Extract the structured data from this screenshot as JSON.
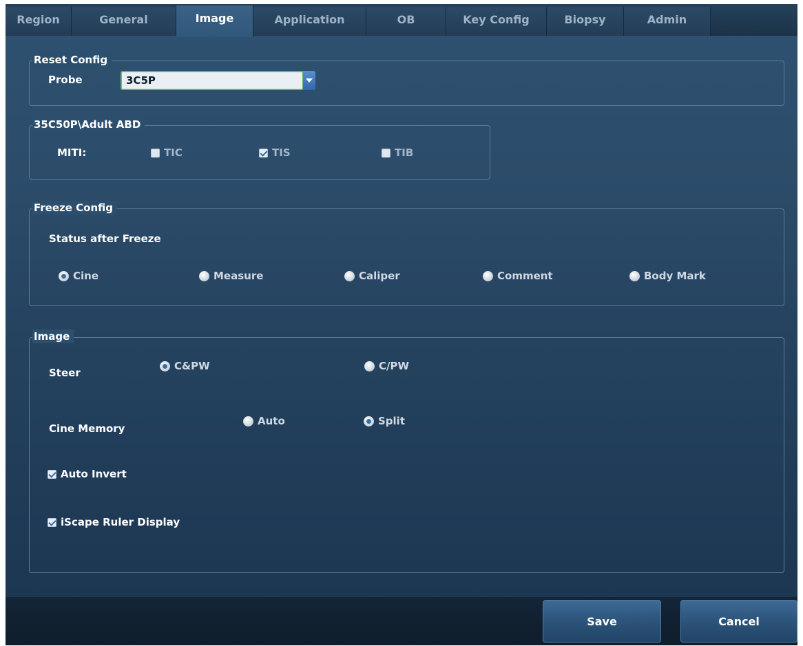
{
  "tabs": [
    "Region",
    "General",
    "Image",
    "Application",
    "OB",
    "Key Config",
    "Biopsy",
    "Admin"
  ],
  "active_tab": "Image",
  "reset_config": {
    "legend": "Reset Config",
    "probe_label": "Probe",
    "probe_value": "3C5P"
  },
  "exam_group": {
    "legend": "35C50P\\Adult ABD",
    "miti_label": "MITI:",
    "options": [
      {
        "label": "TIC",
        "checked": false
      },
      {
        "label": "TIS",
        "checked": true
      },
      {
        "label": "TIB",
        "checked": false
      }
    ]
  },
  "freeze_config": {
    "legend": "Freeze Config",
    "subtitle": "Status after Freeze",
    "options": [
      {
        "label": "Cine",
        "selected": true
      },
      {
        "label": "Measure",
        "selected": false
      },
      {
        "label": "Caliper",
        "selected": false
      },
      {
        "label": "Comment",
        "selected": false
      },
      {
        "label": "Body Mark",
        "selected": false
      }
    ]
  },
  "image_group": {
    "legend": "Image",
    "steer_label": "Steer",
    "steer_options": [
      {
        "label": "C&PW",
        "selected": true
      },
      {
        "label": "C/PW",
        "selected": false
      }
    ],
    "cine_memory_label": "Cine Memory",
    "cine_options": [
      {
        "label": "Auto",
        "selected": false
      },
      {
        "label": "Split",
        "selected": true
      }
    ],
    "auto_invert": {
      "label": "Auto Invert",
      "checked": true
    },
    "iscape_ruler": {
      "label": "iScape Ruler Display",
      "checked": true
    }
  },
  "buttons": {
    "save": "Save",
    "cancel": "Cancel"
  },
  "colors": {
    "panel": "#2b4b69",
    "tab_active": "#30587b",
    "accent_green": "#5fbf5c",
    "radio_selected": "#3a6ea8"
  }
}
